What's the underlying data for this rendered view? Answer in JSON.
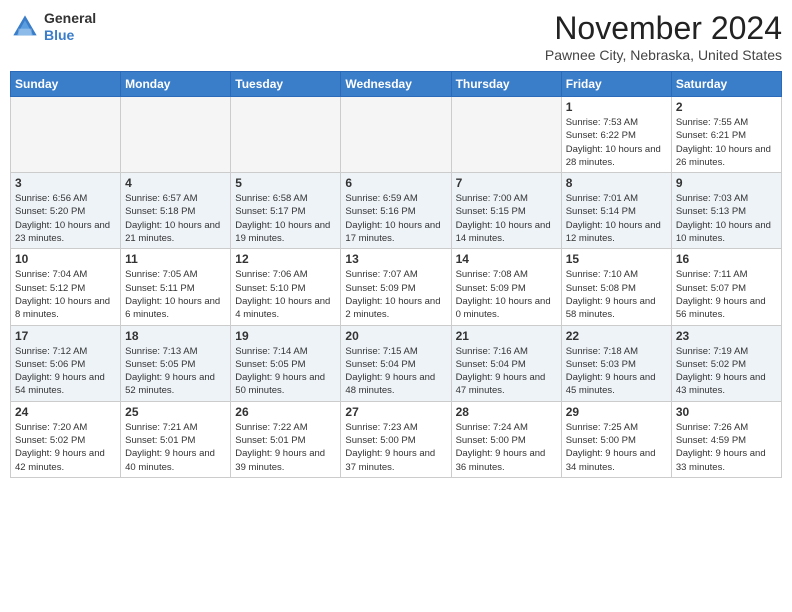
{
  "app": {
    "name": "GeneralBlue",
    "name_general": "General",
    "name_blue": "Blue"
  },
  "header": {
    "month": "November 2024",
    "location": "Pawnee City, Nebraska, United States"
  },
  "weekdays": [
    "Sunday",
    "Monday",
    "Tuesday",
    "Wednesday",
    "Thursday",
    "Friday",
    "Saturday"
  ],
  "weeks": [
    [
      {
        "day": "",
        "info": ""
      },
      {
        "day": "",
        "info": ""
      },
      {
        "day": "",
        "info": ""
      },
      {
        "day": "",
        "info": ""
      },
      {
        "day": "",
        "info": ""
      },
      {
        "day": "1",
        "info": "Sunrise: 7:53 AM\nSunset: 6:22 PM\nDaylight: 10 hours and 28 minutes."
      },
      {
        "day": "2",
        "info": "Sunrise: 7:55 AM\nSunset: 6:21 PM\nDaylight: 10 hours and 26 minutes."
      }
    ],
    [
      {
        "day": "3",
        "info": "Sunrise: 6:56 AM\nSunset: 5:20 PM\nDaylight: 10 hours and 23 minutes."
      },
      {
        "day": "4",
        "info": "Sunrise: 6:57 AM\nSunset: 5:18 PM\nDaylight: 10 hours and 21 minutes."
      },
      {
        "day": "5",
        "info": "Sunrise: 6:58 AM\nSunset: 5:17 PM\nDaylight: 10 hours and 19 minutes."
      },
      {
        "day": "6",
        "info": "Sunrise: 6:59 AM\nSunset: 5:16 PM\nDaylight: 10 hours and 17 minutes."
      },
      {
        "day": "7",
        "info": "Sunrise: 7:00 AM\nSunset: 5:15 PM\nDaylight: 10 hours and 14 minutes."
      },
      {
        "day": "8",
        "info": "Sunrise: 7:01 AM\nSunset: 5:14 PM\nDaylight: 10 hours and 12 minutes."
      },
      {
        "day": "9",
        "info": "Sunrise: 7:03 AM\nSunset: 5:13 PM\nDaylight: 10 hours and 10 minutes."
      }
    ],
    [
      {
        "day": "10",
        "info": "Sunrise: 7:04 AM\nSunset: 5:12 PM\nDaylight: 10 hours and 8 minutes."
      },
      {
        "day": "11",
        "info": "Sunrise: 7:05 AM\nSunset: 5:11 PM\nDaylight: 10 hours and 6 minutes."
      },
      {
        "day": "12",
        "info": "Sunrise: 7:06 AM\nSunset: 5:10 PM\nDaylight: 10 hours and 4 minutes."
      },
      {
        "day": "13",
        "info": "Sunrise: 7:07 AM\nSunset: 5:09 PM\nDaylight: 10 hours and 2 minutes."
      },
      {
        "day": "14",
        "info": "Sunrise: 7:08 AM\nSunset: 5:09 PM\nDaylight: 10 hours and 0 minutes."
      },
      {
        "day": "15",
        "info": "Sunrise: 7:10 AM\nSunset: 5:08 PM\nDaylight: 9 hours and 58 minutes."
      },
      {
        "day": "16",
        "info": "Sunrise: 7:11 AM\nSunset: 5:07 PM\nDaylight: 9 hours and 56 minutes."
      }
    ],
    [
      {
        "day": "17",
        "info": "Sunrise: 7:12 AM\nSunset: 5:06 PM\nDaylight: 9 hours and 54 minutes."
      },
      {
        "day": "18",
        "info": "Sunrise: 7:13 AM\nSunset: 5:05 PM\nDaylight: 9 hours and 52 minutes."
      },
      {
        "day": "19",
        "info": "Sunrise: 7:14 AM\nSunset: 5:05 PM\nDaylight: 9 hours and 50 minutes."
      },
      {
        "day": "20",
        "info": "Sunrise: 7:15 AM\nSunset: 5:04 PM\nDaylight: 9 hours and 48 minutes."
      },
      {
        "day": "21",
        "info": "Sunrise: 7:16 AM\nSunset: 5:04 PM\nDaylight: 9 hours and 47 minutes."
      },
      {
        "day": "22",
        "info": "Sunrise: 7:18 AM\nSunset: 5:03 PM\nDaylight: 9 hours and 45 minutes."
      },
      {
        "day": "23",
        "info": "Sunrise: 7:19 AM\nSunset: 5:02 PM\nDaylight: 9 hours and 43 minutes."
      }
    ],
    [
      {
        "day": "24",
        "info": "Sunrise: 7:20 AM\nSunset: 5:02 PM\nDaylight: 9 hours and 42 minutes."
      },
      {
        "day": "25",
        "info": "Sunrise: 7:21 AM\nSunset: 5:01 PM\nDaylight: 9 hours and 40 minutes."
      },
      {
        "day": "26",
        "info": "Sunrise: 7:22 AM\nSunset: 5:01 PM\nDaylight: 9 hours and 39 minutes."
      },
      {
        "day": "27",
        "info": "Sunrise: 7:23 AM\nSunset: 5:00 PM\nDaylight: 9 hours and 37 minutes."
      },
      {
        "day": "28",
        "info": "Sunrise: 7:24 AM\nSunset: 5:00 PM\nDaylight: 9 hours and 36 minutes."
      },
      {
        "day": "29",
        "info": "Sunrise: 7:25 AM\nSunset: 5:00 PM\nDaylight: 9 hours and 34 minutes."
      },
      {
        "day": "30",
        "info": "Sunrise: 7:26 AM\nSunset: 4:59 PM\nDaylight: 9 hours and 33 minutes."
      }
    ]
  ]
}
